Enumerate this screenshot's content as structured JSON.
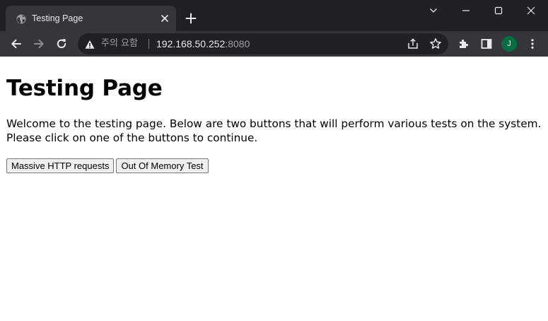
{
  "browser": {
    "tab": {
      "title": "Testing Page"
    },
    "address_bar": {
      "security_label": "주의 요함",
      "host": "192.168.50.252",
      "port": ":8080"
    },
    "profile_initial": "J",
    "colors": {
      "tabstrip": "#202124",
      "toolbar": "#35363a",
      "avatar": "#0b6b45"
    }
  },
  "page": {
    "title": "Testing Page",
    "intro": "Welcome to the testing page. Below are two buttons that will perform various tests on the system. Please click on one of the buttons to continue.",
    "buttons": [
      {
        "label": "Massive HTTP requests"
      },
      {
        "label": "Out Of Memory Test"
      }
    ]
  }
}
